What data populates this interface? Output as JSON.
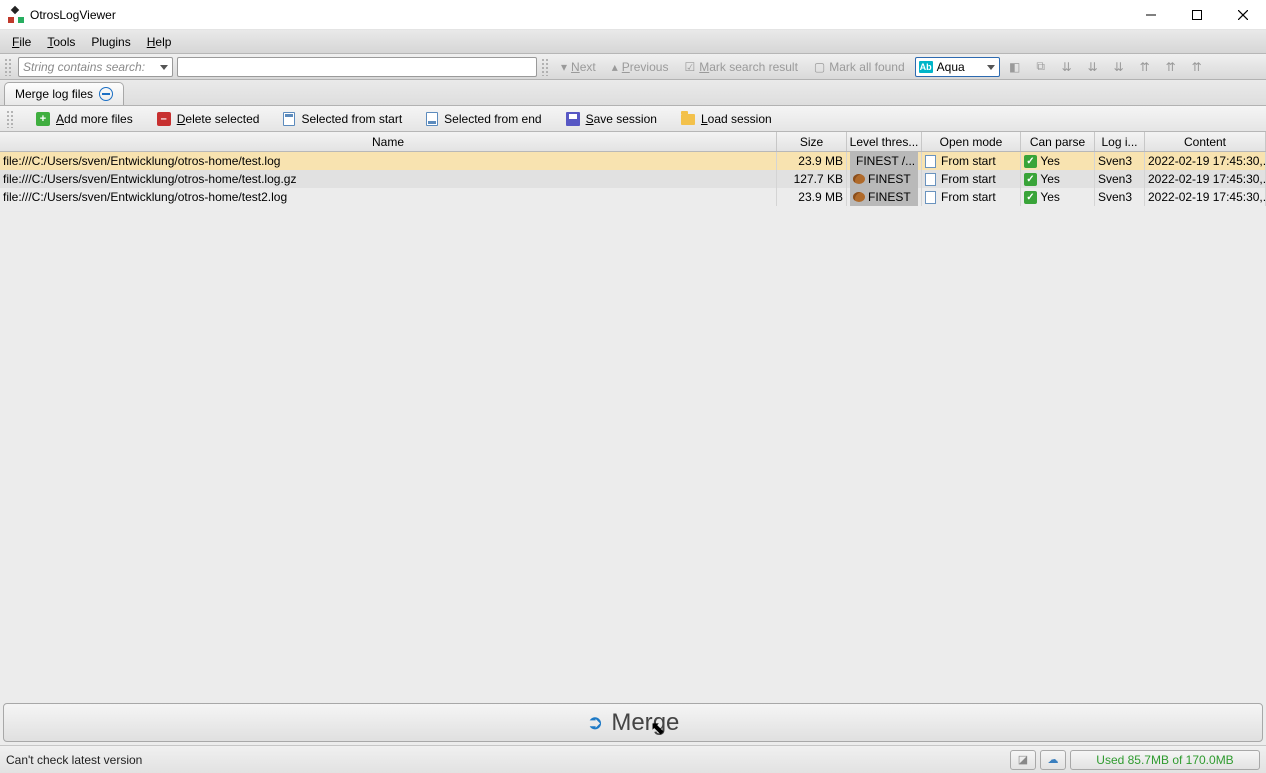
{
  "window": {
    "title": "OtrosLogViewer"
  },
  "menu": {
    "file": "File",
    "tools": "Tools",
    "plugins": "Plugins",
    "help": "Help"
  },
  "toolbar": {
    "search_mode": "String contains search:",
    "search_value": "",
    "next": "Next",
    "previous": "Previous",
    "mark_search": "Mark search result",
    "mark_all": "Mark all found",
    "color_option": "Aqua",
    "color_prefix": "Ab"
  },
  "tab": {
    "label": "Merge log files"
  },
  "actions": {
    "add": "Add more files",
    "delete": "Delete selected",
    "sel_start": "Selected from start",
    "sel_end": "Selected from end",
    "save": "Save session",
    "load": "Load session"
  },
  "table": {
    "headers": {
      "name": "Name",
      "size": "Size",
      "level": "Level thres...",
      "open": "Open mode",
      "parse": "Can parse",
      "imp": "Log i...",
      "content": "Content"
    },
    "rows": [
      {
        "name": "file:///C:/Users/sven/Entwicklung/otros-home/test.log",
        "size": "23.9 MB",
        "level": "FINEST /...",
        "open": "From start",
        "parse": "Yes",
        "imp": "Sven3",
        "content": "2022-02-19 17:45:30,..."
      },
      {
        "name": "file:///C:/Users/sven/Entwicklung/otros-home/test.log.gz",
        "size": "127.7 KB",
        "level": "FINEST",
        "open": "From start",
        "parse": "Yes",
        "imp": "Sven3",
        "content": "2022-02-19 17:45:30,..."
      },
      {
        "name": "file:///C:/Users/sven/Entwicklung/otros-home/test2.log",
        "size": "23.9 MB",
        "level": "FINEST",
        "open": "From start",
        "parse": "Yes",
        "imp": "Sven3",
        "content": "2022-02-19 17:45:30,..."
      }
    ]
  },
  "merge": {
    "label": "Merge"
  },
  "status": {
    "message": "Can't check latest version",
    "memory": "Used 85.7MB of 170.0MB"
  }
}
